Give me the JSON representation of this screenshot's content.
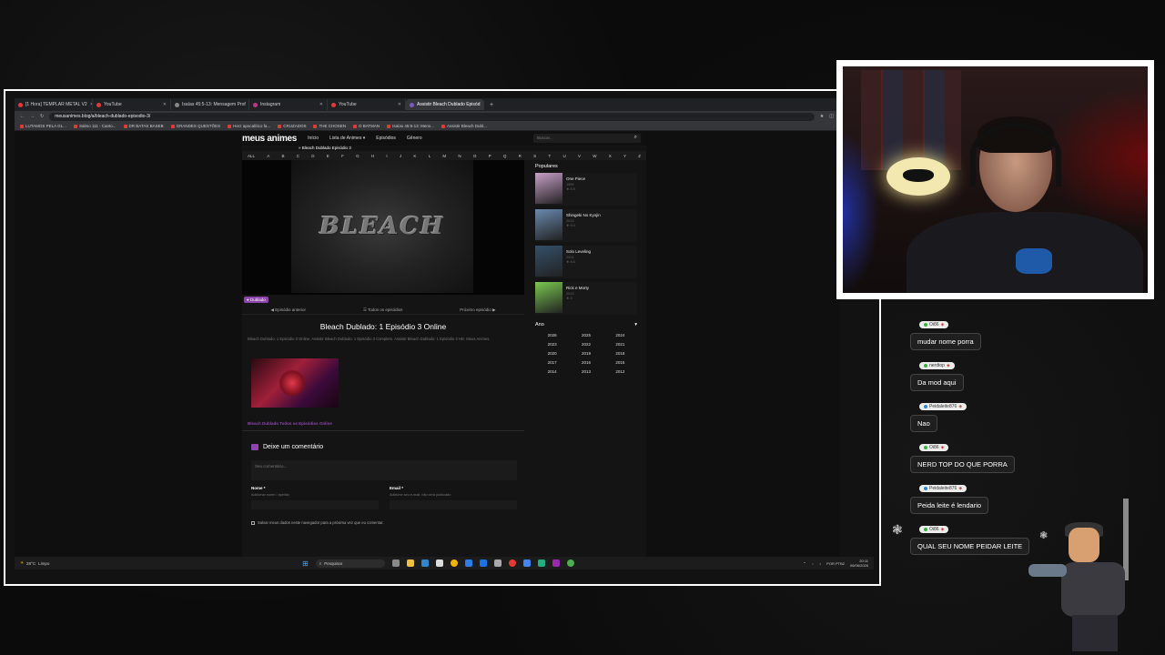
{
  "browser": {
    "tabs": [
      {
        "label": "[1 Hora] TEMPLAR METAL V2",
        "icon": "youtube-icon",
        "active": false
      },
      {
        "label": "YouTube",
        "icon": "youtube-icon",
        "active": false
      },
      {
        "label": "Isaías 45:5-13: Mensagem Prof",
        "icon": "generic-icon",
        "active": false
      },
      {
        "label": "Instagram",
        "icon": "instagram-icon",
        "active": false
      },
      {
        "label": "YouTube",
        "icon": "youtube-icon",
        "active": false
      },
      {
        "label": "Assistir Bleach Dublado Episód",
        "icon": "site-icon",
        "active": true
      }
    ],
    "url": "meusanimes.blog/a/bleach-dublado-episodio-3/",
    "bookmarks": [
      "LUTAMOS PELA GL...",
      "Salmo 111 - Canto...",
      "DR BATAS BASEB",
      "GRANDES QUESTÕES",
      "Herz apocalítico fa...",
      "CRUZADOS",
      "THE CHOSEN",
      "O BATMAN",
      "Isaías 45:5-13: Mens...",
      "Assistir Bleach Dubl..."
    ]
  },
  "site": {
    "logo": "meus animes",
    "nav": [
      "Início",
      "Lista de Animes ▾",
      "Episódios",
      "Gênero"
    ],
    "search_placeholder": "Buscar...",
    "breadcrumb": "» Bleach Dublado Episódio 3",
    "alphabet": [
      "ALL",
      "A",
      "B",
      "C",
      "D",
      "E",
      "F",
      "G",
      "H",
      "I",
      "J",
      "K",
      "L",
      "M",
      "N",
      "O",
      "P",
      "Q",
      "R",
      "S",
      "T",
      "U",
      "V",
      "W",
      "X",
      "Y",
      "Z"
    ],
    "player_logo": "BLEACH",
    "badge": "Dublado",
    "prev_ep": "Episódio anterior",
    "all_eps_btn": "Todos os episódios",
    "next_ep": "Próximo episódio",
    "title": "Bleach Dublado: 1 Episódio 3 Online",
    "description": "Bleach Dublado: 1 Episódio 3 Online. Assistir Bleach Dublado: 1 Episódio 3 Completo. Assistir Bleach Dublado: 1 Episódio 3 HD. Meus Animes.",
    "all_eps_link": "Bleach Dublado Todos os Episódios Online",
    "comments_heading": "Deixe um comentário",
    "comment_placeholder": "Seu comentário...",
    "name_label": "Nome *",
    "name_hint": "Adicionar nome / apelido",
    "email_label": "Email *",
    "email_hint": "Adicione seu e-mail, não será publicado",
    "save_label": "Salvar meus dados neste navegador para a próxima vez que eu comentar.",
    "popular_heading": "Populares",
    "popular": [
      {
        "title": "One Piece",
        "year": "1999",
        "rating": "8.9",
        "color": "#c8a0c8"
      },
      {
        "title": "Shingeki No Kyojin",
        "year": "2013",
        "rating": "9.0",
        "color": "#6a8ab0"
      },
      {
        "title": "Solo Leveling",
        "year": "2024",
        "rating": "8.5",
        "color": "#34506a"
      },
      {
        "title": "Rick e Morty",
        "year": "2013",
        "rating": "9",
        "color": "#7ac850"
      }
    ],
    "year_heading": "Ano",
    "years": [
      "2026",
      "2025",
      "2024",
      "2023",
      "2022",
      "2021",
      "2020",
      "2019",
      "2018",
      "2017",
      "2016",
      "2015",
      "2014",
      "2013",
      "2012"
    ]
  },
  "taskbar": {
    "weather_temp": "28°C",
    "weather_label": "Limpo",
    "search_label": "Pesquisar",
    "lang": "POR PTB2",
    "time": "20:11",
    "date": "06/06/2026"
  },
  "chat": [
    {
      "user": "Oi86",
      "badge": "green",
      "text": "mudar nome porra"
    },
    {
      "user": "nerdtop",
      "badge": "green",
      "text": "Da mod aqui"
    },
    {
      "user": "Peidaleite876",
      "badge": "blue",
      "text": "Nao"
    },
    {
      "user": "Oi86",
      "badge": "green",
      "text": "NERD TOP DO QUE PORRA"
    },
    {
      "user": "Peidaleite876",
      "badge": "blue",
      "text": "Peida leite é lendario"
    },
    {
      "user": "Oi86",
      "badge": "green",
      "text": "QUAL SEU NOME PEIDAR LEITE"
    }
  ],
  "colors": {
    "accent": "#8e44ad",
    "background": "#0c0c0c",
    "youtube": "#e53935"
  }
}
